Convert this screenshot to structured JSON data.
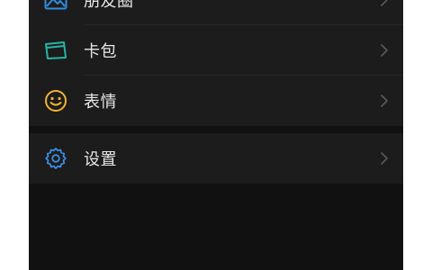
{
  "menu": {
    "group1": [
      {
        "label": "朋友圈",
        "icon": "photo-album-icon"
      },
      {
        "label": "卡包",
        "icon": "card-wallet-icon"
      },
      {
        "label": "表情",
        "icon": "smiley-face-icon"
      }
    ],
    "group2": [
      {
        "label": "设置",
        "icon": "settings-gear-icon"
      }
    ]
  },
  "colors": {
    "background": "#111111",
    "row_background": "#1c1c1c",
    "text": "#e8e8e8",
    "chevron": "#5a5a5a",
    "album_blue": "#2f8ee0",
    "card_green": "#28b4a0",
    "emoji_yellow": "#f0b42d",
    "gear_blue": "#3d8de0"
  }
}
